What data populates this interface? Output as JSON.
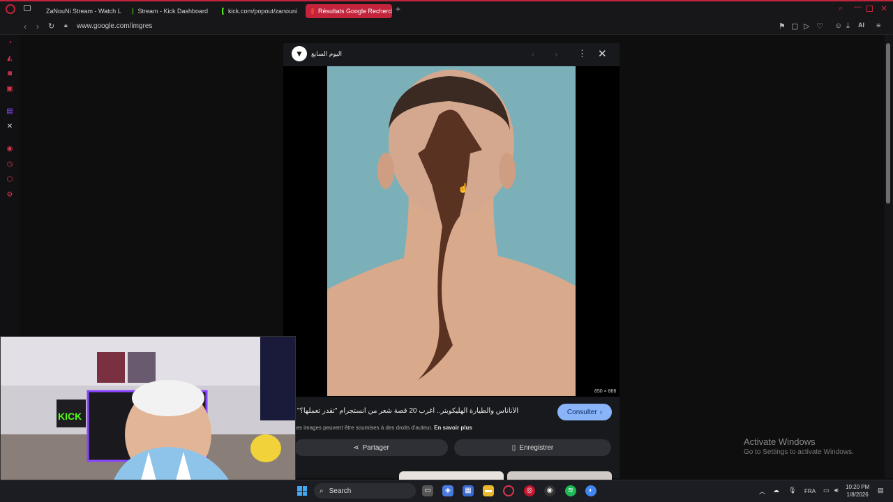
{
  "tabs": [
    {
      "label": "ZaNouNi Stream - Watch L",
      "icon": "kick-icon"
    },
    {
      "label": "Stream - Kick Dashboard",
      "icon": "kick-icon"
    },
    {
      "label": "kick.com/popout/zanouni",
      "icon": "kick-icon"
    },
    {
      "label": "Résultats Google Recherch",
      "icon": "google-icon",
      "active": true
    }
  ],
  "address": {
    "url": "www.google.com/imgres"
  },
  "toolbar": {
    "ai_label": "AI"
  },
  "preview": {
    "source_name": "اليوم السابع",
    "image_size": "650 × 866",
    "title": "الأناناس والطيارة الهليكوبتر.. أغرب 20 قصة شعر من انستجرام \"تقدر تعملها؟\"",
    "consult_label": "Consulter",
    "rights_text": "Les images peuvent être soumises à des droits d'auteur.",
    "rights_link": "En savoir plus",
    "share_label": "Partager",
    "save_label": "Enregistrer"
  },
  "watermark": {
    "line1": "Activate Windows",
    "line2": "Go to Settings to activate Windows."
  },
  "taskbar": {
    "search_placeholder": "Search",
    "language": "FRA",
    "time": "10:20 PM",
    "date": "1/8/2026"
  },
  "webcam": {
    "sign_text": "KICK"
  },
  "colors": {
    "accent": "#c3243b",
    "kick": "#53fc18",
    "consult": "#8ab4f8"
  }
}
